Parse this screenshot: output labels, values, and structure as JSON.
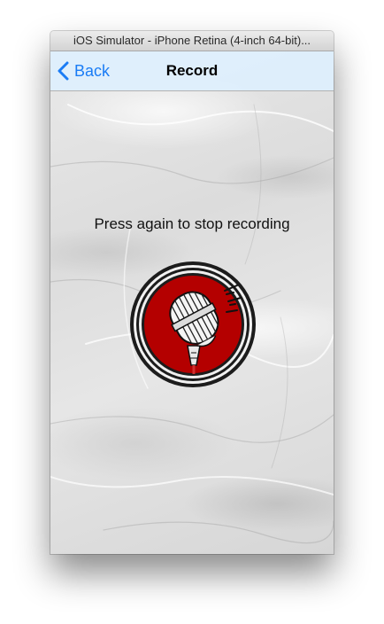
{
  "window": {
    "title": "iOS Simulator - iPhone Retina (4-inch 64-bit)..."
  },
  "navbar": {
    "back_label": "Back",
    "title": "Record"
  },
  "main": {
    "instruction": "Press again to stop recording"
  },
  "colors": {
    "nav_background": "#deeefc",
    "accent": "#1a7cf5",
    "record_button_red": "#b40000"
  },
  "icons": {
    "back": "chevron-left-icon",
    "record": "microphone-icon"
  }
}
